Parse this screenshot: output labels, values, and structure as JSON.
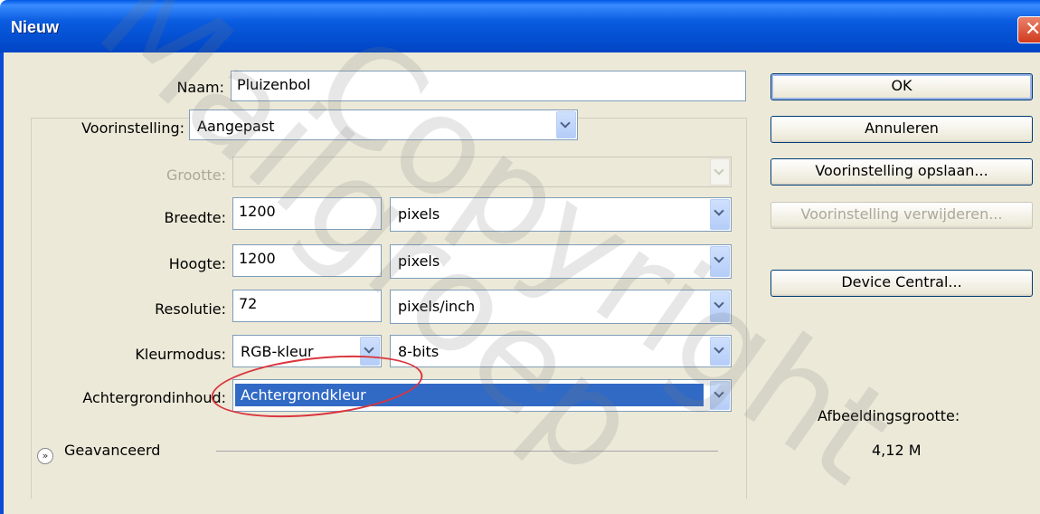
{
  "window": {
    "title": "Nieuw",
    "close_icon": "close-icon"
  },
  "fields": {
    "naam_label": "Naam:",
    "naam_value": "Pluizenbol",
    "voorinstelling_label": "Voorinstelling:",
    "voorinstelling_value": "Aangepast",
    "grootte_label": "Grootte:",
    "grootte_value": "",
    "breedte_label": "Breedte:",
    "breedte_value": "1200",
    "breedte_unit": "pixels",
    "hoogte_label": "Hoogte:",
    "hoogte_value": "1200",
    "hoogte_unit": "pixels",
    "resolutie_label": "Resolutie:",
    "resolutie_value": "72",
    "resolutie_unit": "pixels/inch",
    "kleurmodus_label": "Kleurmodus:",
    "kleurmodus_value": "RGB-kleur",
    "bits_value": "8-bits",
    "achtergrond_label": "Achtergrondinhoud:",
    "achtergrond_value": "Achtergrondkleur",
    "advanced_label": "Geavanceerd"
  },
  "buttons": {
    "ok": "OK",
    "cancel": "Annuleren",
    "save_preset": "Voorinstelling opslaan...",
    "delete_preset": "Voorinstelling verwijderen...",
    "device_central": "Device Central..."
  },
  "info": {
    "size_label": "Afbeeldingsgrootte:",
    "size_value": "4,12 M"
  },
  "watermark": {
    "line1": "Copyright",
    "line2": "Mailgroep"
  },
  "colors": {
    "titlebar": "#0a5ce0",
    "highlight": "#316ac5",
    "annotation": "#d9363e"
  }
}
